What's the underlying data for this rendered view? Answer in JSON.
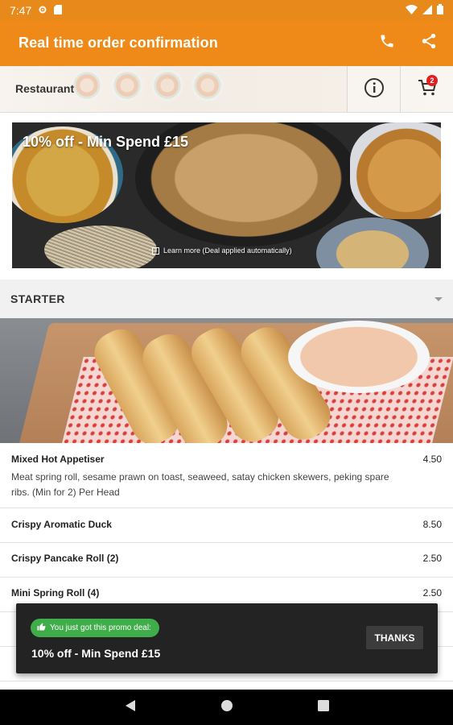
{
  "status_bar": {
    "time": "7:47"
  },
  "app_bar": {
    "title": "Real time order confirmation"
  },
  "restaurant_header": {
    "label": "Restaurant",
    "cart_count": "2"
  },
  "banner": {
    "promo_text": "10% off - Min Spend £15",
    "learn_more": "Learn more (Deal applied automatically)"
  },
  "category": {
    "name": "STARTER"
  },
  "menu_items": [
    {
      "name": "Mixed Hot Appetiser",
      "price": "4.50",
      "description": "Meat spring roll, sesame prawn on toast, seaweed, satay chicken skewers, peking spare ribs. (Min for 2) Per Head"
    },
    {
      "name": "Crispy Aromatic Duck",
      "price": "8.50"
    },
    {
      "name": "Crispy Pancake Roll (2)",
      "price": "2.50"
    },
    {
      "name": "Mini Spring Roll (4)",
      "price": "2.50"
    }
  ],
  "snackbar": {
    "pill_text": "You just got this promo deal:",
    "deal_text": "10% off - Min Spend £15",
    "button_label": "THANKS"
  },
  "colors": {
    "primary": "#ef8a18",
    "status_bar": "#e8891b",
    "promo_green": "#3fae4a",
    "badge": "#e02020"
  }
}
